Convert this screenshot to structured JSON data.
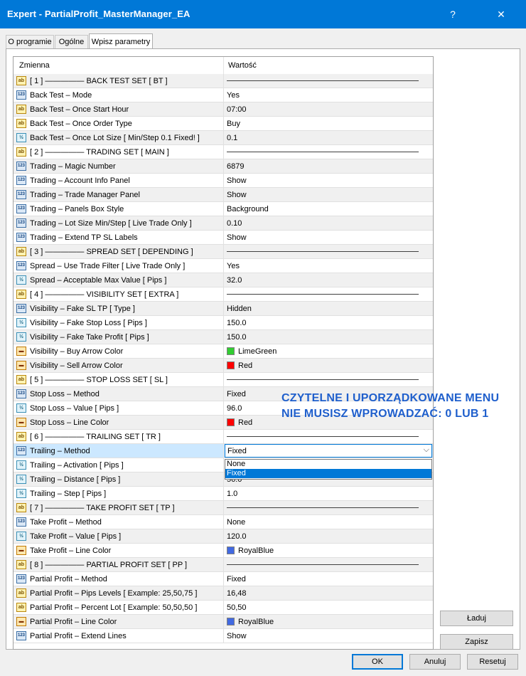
{
  "window": {
    "title": "Expert - PartialProfit_MasterManager_EA",
    "help_glyph": "?",
    "close_glyph": "✕"
  },
  "tabs": [
    {
      "label": "O programie"
    },
    {
      "label": "Ogólne"
    },
    {
      "label": "Wpisz parametry"
    }
  ],
  "grid": {
    "col_name": "Zmienna",
    "col_value": "Wartość",
    "rows": [
      {
        "icon": "ab",
        "name": "[ 1 ] ————— BACK TEST SET [ BT ]",
        "sep": true
      },
      {
        "icon": "123",
        "name": "Back Test – Mode",
        "value": "Yes"
      },
      {
        "icon": "ab",
        "name": "Back Test – Once Start Hour",
        "value": "07:00"
      },
      {
        "icon": "ab",
        "name": "Back Test – Once Order Type",
        "value": "Buy"
      },
      {
        "icon": "half",
        "name": "Back Test – Once Lot Size [ Min/Step 0.1 Fixed! ]",
        "value": "0.1"
      },
      {
        "icon": "ab",
        "name": "[ 2 ] ————— TRADING SET [ MAIN ]",
        "sep": true
      },
      {
        "icon": "123",
        "name": "Trading – Magic Number",
        "value": "6879"
      },
      {
        "icon": "123",
        "name": "Trading – Account Info Panel",
        "value": "Show"
      },
      {
        "icon": "123",
        "name": "Trading – Trade Manager Panel",
        "value": "Show"
      },
      {
        "icon": "123",
        "name": "Trading – Panels Box Style",
        "value": "Background"
      },
      {
        "icon": "123",
        "name": "Trading – Lot Size Min/Step [ Live Trade Only ]",
        "value": "0.10"
      },
      {
        "icon": "123",
        "name": "Trading – Extend TP SL Labels",
        "value": "Show"
      },
      {
        "icon": "ab",
        "name": "[ 3 ] ————— SPREAD SET [ DEPENDING ]",
        "sep": true
      },
      {
        "icon": "123",
        "name": "Spread – Use Trade Filter [ Live Trade Only ]",
        "value": "Yes"
      },
      {
        "icon": "half",
        "name": "Spread – Acceptable Max Value [ Pips ]",
        "value": "32.0"
      },
      {
        "icon": "ab",
        "name": "[ 4 ] ————— VISIBILITY SET [ EXTRA ]",
        "sep": true
      },
      {
        "icon": "123",
        "name": "Visibility – Fake SL TP [ Type ]",
        "value": "Hidden"
      },
      {
        "icon": "half",
        "name": "Visibility – Fake Stop Loss [ Pips ]",
        "value": "150.0"
      },
      {
        "icon": "half",
        "name": "Visibility – Fake Take Profit [ Pips ]",
        "value": "150.0"
      },
      {
        "icon": "clr",
        "name": "Visibility – Buy Arrow Color",
        "value": "LimeGreen",
        "color": "#32cd32"
      },
      {
        "icon": "clr",
        "name": "Visibility – Sell Arrow Color",
        "value": "Red",
        "color": "#ff0000"
      },
      {
        "icon": "ab",
        "name": "[ 5 ] ————— STOP LOSS SET [ SL ]",
        "sep": true
      },
      {
        "icon": "123",
        "name": "Stop Loss – Method",
        "value": "Fixed"
      },
      {
        "icon": "half",
        "name": "Stop Loss – Value [ Pips ]",
        "value": "96.0"
      },
      {
        "icon": "clr",
        "name": "Stop Loss – Line Color",
        "value": "Red",
        "color": "#ff0000"
      },
      {
        "icon": "ab",
        "name": "[ 6 ] ————— TRAILING SET [ TR ]",
        "sep": true
      },
      {
        "icon": "123",
        "name": "Trailing – Method",
        "value": "Fixed",
        "combo": true
      },
      {
        "icon": "half",
        "name": "Trailing – Activation [ Pips ]",
        "value": ""
      },
      {
        "icon": "half",
        "name": "Trailing – Distance [ Pips ]",
        "value": "56.0"
      },
      {
        "icon": "half",
        "name": "Trailing – Step [ Pips ]",
        "value": "1.0"
      },
      {
        "icon": "ab",
        "name": "[ 7 ] ————— TAKE PROFIT SET [ TP ]",
        "sep": true
      },
      {
        "icon": "123",
        "name": "Take Profit – Method",
        "value": "None"
      },
      {
        "icon": "half",
        "name": "Take Profit – Value [ Pips ]",
        "value": "120.0"
      },
      {
        "icon": "clr",
        "name": "Take Profit – Line Color",
        "value": "RoyalBlue",
        "color": "#4169e1"
      },
      {
        "icon": "ab",
        "name": "[ 8 ] ————— PARTIAL PROFIT SET [ PP ]",
        "sep": true
      },
      {
        "icon": "123",
        "name": "Partial Profit – Method",
        "value": "Fixed"
      },
      {
        "icon": "ab",
        "name": "Partial Profit – Pips Levels [ Example: 25,50,75 ]",
        "value": "16,48"
      },
      {
        "icon": "ab",
        "name": "Partial Profit – Percent Lot [ Example: 50,50,50 ]",
        "value": "50,50"
      },
      {
        "icon": "clr",
        "name": "Partial Profit – Line Color",
        "value": "RoyalBlue",
        "color": "#4169e1"
      },
      {
        "icon": "123",
        "name": "Partial Profit – Extend Lines",
        "value": "Show"
      }
    ]
  },
  "dropdown": {
    "options": [
      {
        "label": "None",
        "selected": false
      },
      {
        "label": "Fixed",
        "selected": true
      }
    ]
  },
  "annotation": {
    "line1": "CZYTELNE I UPORZĄDKOWANE MENU",
    "line2": "NIE MUSISZ WPROWADZAĆ: 0 LUB 1"
  },
  "side_buttons": {
    "load": "Ładuj",
    "save": "Zapisz"
  },
  "footer_buttons": {
    "ok": "OK",
    "cancel": "Anuluj",
    "reset": "Resetuj"
  },
  "icon_labels": {
    "ab": "ab",
    "123": "123",
    "half": "½",
    "clr": "▬"
  }
}
